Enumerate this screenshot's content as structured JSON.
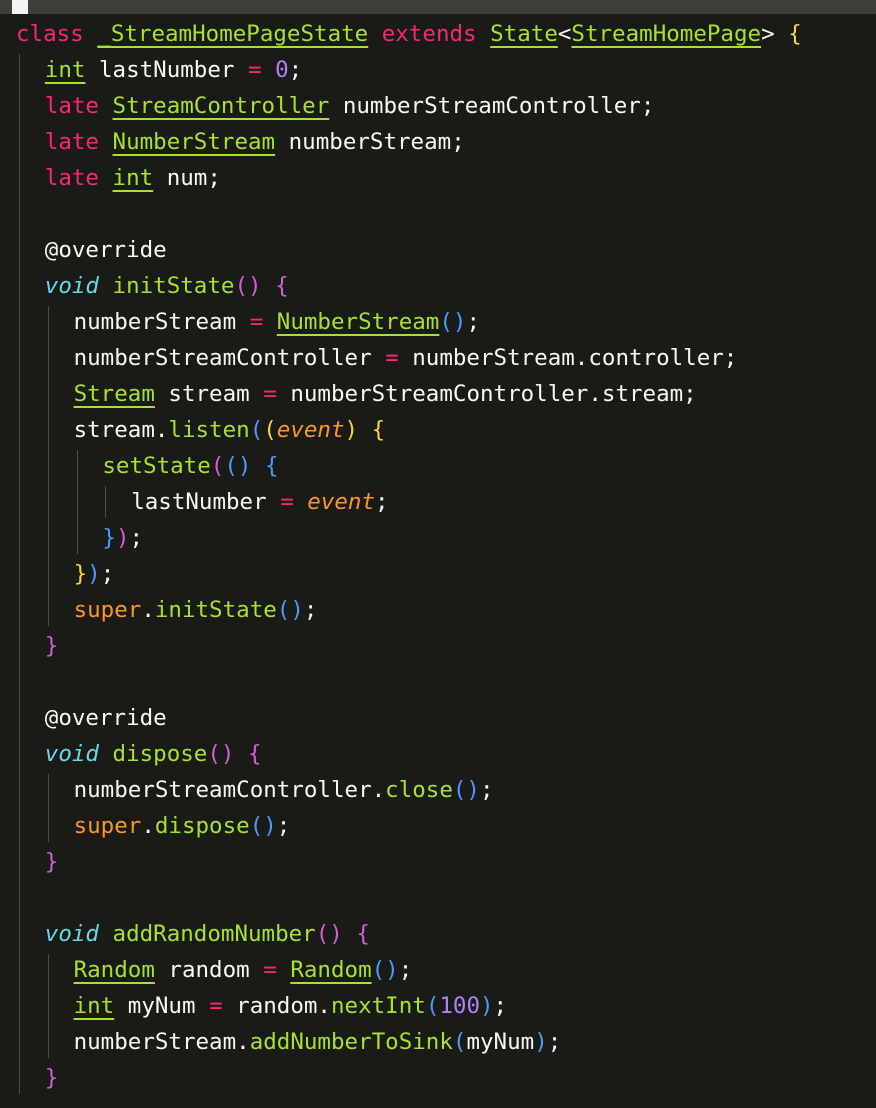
{
  "editor": {
    "title_bar_cursor": "",
    "lines": [
      {
        "indent": 0,
        "tokens": [
          [
            "kw-red",
            "class"
          ],
          [
            "pl",
            " "
          ],
          [
            "cls",
            "_StreamHomePageState"
          ],
          [
            "pl",
            " "
          ],
          [
            "kw-red",
            "extends"
          ],
          [
            "pl",
            " "
          ],
          [
            "cls",
            "State"
          ],
          [
            "pl",
            "<"
          ],
          [
            "cls",
            "StreamHomePage"
          ],
          [
            "pl",
            "> "
          ],
          [
            "b3",
            "{"
          ]
        ]
      },
      {
        "indent": 1,
        "tokens": [
          [
            "cls",
            "int"
          ],
          [
            "pl",
            " lastNumber "
          ],
          [
            "op",
            "="
          ],
          [
            "pl",
            " "
          ],
          [
            "num",
            "0"
          ],
          [
            "pl",
            ";"
          ]
        ]
      },
      {
        "indent": 1,
        "tokens": [
          [
            "kw-red",
            "late"
          ],
          [
            "pl",
            " "
          ],
          [
            "cls",
            "StreamController"
          ],
          [
            "pl",
            " numberStreamController;"
          ]
        ]
      },
      {
        "indent": 1,
        "tokens": [
          [
            "kw-red",
            "late"
          ],
          [
            "pl",
            " "
          ],
          [
            "cls",
            "NumberStream"
          ],
          [
            "pl",
            " numberStream;"
          ]
        ]
      },
      {
        "indent": 1,
        "tokens": [
          [
            "kw-red",
            "late"
          ],
          [
            "pl",
            " "
          ],
          [
            "cls",
            "int"
          ],
          [
            "pl",
            " num;"
          ]
        ]
      },
      {
        "indent": 1,
        "tokens": []
      },
      {
        "indent": 1,
        "tokens": [
          [
            "ann",
            "@override"
          ]
        ]
      },
      {
        "indent": 1,
        "tokens": [
          [
            "kw-it",
            "void"
          ],
          [
            "pl",
            " "
          ],
          [
            "fn",
            "initState"
          ],
          [
            "b1",
            "()"
          ],
          [
            "pl",
            " "
          ],
          [
            "b1",
            "{"
          ]
        ]
      },
      {
        "indent": 2,
        "tokens": [
          [
            "pl",
            "numberStream "
          ],
          [
            "op",
            "="
          ],
          [
            "pl",
            " "
          ],
          [
            "cls",
            "NumberStream"
          ],
          [
            "b2",
            "()"
          ],
          [
            "pl",
            ";"
          ]
        ]
      },
      {
        "indent": 2,
        "tokens": [
          [
            "pl",
            "numberStreamController "
          ],
          [
            "op",
            "="
          ],
          [
            "pl",
            " numberStream.controller;"
          ]
        ]
      },
      {
        "indent": 2,
        "tokens": [
          [
            "cls",
            "Stream"
          ],
          [
            "pl",
            " stream "
          ],
          [
            "op",
            "="
          ],
          [
            "pl",
            " numberStreamController.stream;"
          ]
        ]
      },
      {
        "indent": 2,
        "tokens": [
          [
            "pl",
            "stream."
          ],
          [
            "fn",
            "listen"
          ],
          [
            "b2",
            "("
          ],
          [
            "b3",
            "("
          ],
          [
            "param",
            "event"
          ],
          [
            "b3",
            ")"
          ],
          [
            "pl",
            " "
          ],
          [
            "b3",
            "{"
          ]
        ]
      },
      {
        "indent": 3,
        "tokens": [
          [
            "fn",
            "setState"
          ],
          [
            "b1",
            "("
          ],
          [
            "b2",
            "()"
          ],
          [
            "pl",
            " "
          ],
          [
            "b2",
            "{"
          ]
        ]
      },
      {
        "indent": 4,
        "tokens": [
          [
            "pl",
            "lastNumber "
          ],
          [
            "op",
            "="
          ],
          [
            "pl",
            " "
          ],
          [
            "param",
            "event"
          ],
          [
            "pl",
            ";"
          ]
        ]
      },
      {
        "indent": 3,
        "tokens": [
          [
            "b2",
            "}"
          ],
          [
            "b1",
            ")"
          ],
          [
            "pl",
            ";"
          ]
        ]
      },
      {
        "indent": 2,
        "tokens": [
          [
            "b3",
            "}"
          ],
          [
            "b2",
            ")"
          ],
          [
            "pl",
            ";"
          ]
        ]
      },
      {
        "indent": 2,
        "tokens": [
          [
            "sup",
            "super"
          ],
          [
            "pl",
            "."
          ],
          [
            "fn",
            "initState"
          ],
          [
            "b2",
            "()"
          ],
          [
            "pl",
            ";"
          ]
        ]
      },
      {
        "indent": 1,
        "tokens": [
          [
            "b1",
            "}"
          ]
        ]
      },
      {
        "indent": 1,
        "tokens": []
      },
      {
        "indent": 1,
        "tokens": [
          [
            "ann",
            "@override"
          ]
        ]
      },
      {
        "indent": 1,
        "tokens": [
          [
            "kw-it",
            "void"
          ],
          [
            "pl",
            " "
          ],
          [
            "fn",
            "dispose"
          ],
          [
            "b1",
            "()"
          ],
          [
            "pl",
            " "
          ],
          [
            "b1",
            "{"
          ]
        ]
      },
      {
        "indent": 2,
        "tokens": [
          [
            "pl",
            "numberStreamController."
          ],
          [
            "fn",
            "close"
          ],
          [
            "b2",
            "()"
          ],
          [
            "pl",
            ";"
          ]
        ]
      },
      {
        "indent": 2,
        "tokens": [
          [
            "sup",
            "super"
          ],
          [
            "pl",
            "."
          ],
          [
            "fn",
            "dispose"
          ],
          [
            "b2",
            "()"
          ],
          [
            "pl",
            ";"
          ]
        ]
      },
      {
        "indent": 1,
        "tokens": [
          [
            "b1",
            "}"
          ]
        ]
      },
      {
        "indent": 1,
        "tokens": []
      },
      {
        "indent": 1,
        "tokens": [
          [
            "kw-it",
            "void"
          ],
          [
            "pl",
            " "
          ],
          [
            "fn",
            "addRandomNumber"
          ],
          [
            "b1",
            "()"
          ],
          [
            "pl",
            " "
          ],
          [
            "b1",
            "{"
          ]
        ]
      },
      {
        "indent": 2,
        "tokens": [
          [
            "cls",
            "Random"
          ],
          [
            "pl",
            " random "
          ],
          [
            "op",
            "="
          ],
          [
            "pl",
            " "
          ],
          [
            "cls",
            "Random"
          ],
          [
            "b2",
            "()"
          ],
          [
            "pl",
            ";"
          ]
        ]
      },
      {
        "indent": 2,
        "tokens": [
          [
            "cls",
            "int"
          ],
          [
            "pl",
            " myNum "
          ],
          [
            "op",
            "="
          ],
          [
            "pl",
            " random."
          ],
          [
            "fn",
            "nextInt"
          ],
          [
            "b2",
            "("
          ],
          [
            "num",
            "100"
          ],
          [
            "b2",
            ")"
          ],
          [
            "pl",
            ";"
          ]
        ]
      },
      {
        "indent": 2,
        "tokens": [
          [
            "pl",
            "numberStream."
          ],
          [
            "fn",
            "addNumberToSink"
          ],
          [
            "b2",
            "("
          ],
          [
            "pl",
            "myNum"
          ],
          [
            "b2",
            ")"
          ],
          [
            "pl",
            ";"
          ]
        ]
      },
      {
        "indent": 1,
        "tokens": [
          [
            "b1",
            "}"
          ]
        ]
      }
    ]
  },
  "colors": {
    "background": "#1a1b17",
    "keyword": "#f92672",
    "type": "#a6e22e",
    "function": "#a6e22e",
    "number": "#ae81ff",
    "param": "#fd971f",
    "bracket_level1": "#d45ed7",
    "bracket_level2": "#4b9bff",
    "bracket_level3": "#ffd33a"
  }
}
